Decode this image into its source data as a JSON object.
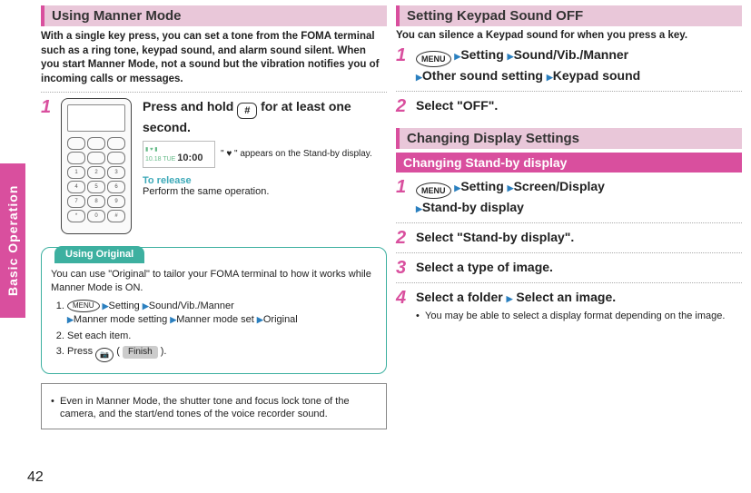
{
  "sideTab": "Basic Operation",
  "pageNumber": "42",
  "left": {
    "heading": "Using Manner Mode",
    "intro": "With a single key press, you can set a tone from the FOMA terminal such as a ring tone, keypad sound, and alarm sound silent. When you start Manner Mode, not a sound but the vibration notifies you of incoming calls or messages.",
    "step1": {
      "num": "1",
      "titleA": "Press and hold ",
      "key": "#",
      "titleB": " for at least one second.",
      "clockTime": "10:00",
      "clockDate": "10.18 TUE",
      "annot": "\" ♥ \" appears on the Stand-by display.",
      "releaseLabel": "To release",
      "releaseText": "Perform the same operation."
    },
    "tip": {
      "tab": "Using Original",
      "body": "You can use \"Original\" to tailor your FOMA terminal to how it works while Manner Mode is ON.",
      "li1_menu": "MENU",
      "li1_a": "Setting",
      "li1_b": "Sound/Vib./Manner",
      "li1_c": "Manner mode setting",
      "li1_d": "Manner mode set",
      "li1_e": "Original",
      "li2": "Set each item.",
      "li3_a": "Press ",
      "li3_cam": "📷",
      "li3_finish": "Finish",
      "li3_b": "( ",
      "li3_c": " )."
    },
    "note": "Even in Manner Mode, the shutter tone and focus lock tone of the camera, and the start/end tones of the voice recorder sound."
  },
  "right": {
    "h1": "Setting Keypad Sound OFF",
    "h1_intro": "You can silence a Keypad sound for when you press a key.",
    "s1": {
      "num": "1",
      "menu": "MENU",
      "a": "Setting",
      "b": "Sound/Vib./Manner",
      "c": "Other sound setting",
      "d": "Keypad sound"
    },
    "s2": {
      "num": "2",
      "text": "Select \"OFF\"."
    },
    "h2": "Changing Display Settings",
    "sub": "Changing Stand-by display",
    "d1": {
      "num": "1",
      "menu": "MENU",
      "a": "Setting",
      "b": "Screen/Display",
      "c": "Stand-by display"
    },
    "d2": {
      "num": "2",
      "text": "Select \"Stand-by display\"."
    },
    "d3": {
      "num": "3",
      "text": "Select a type of image."
    },
    "d4": {
      "num": "4",
      "a": "Select a folder",
      "b": "Select an image.",
      "note": "You may be able to select a display format depending on the image."
    }
  }
}
